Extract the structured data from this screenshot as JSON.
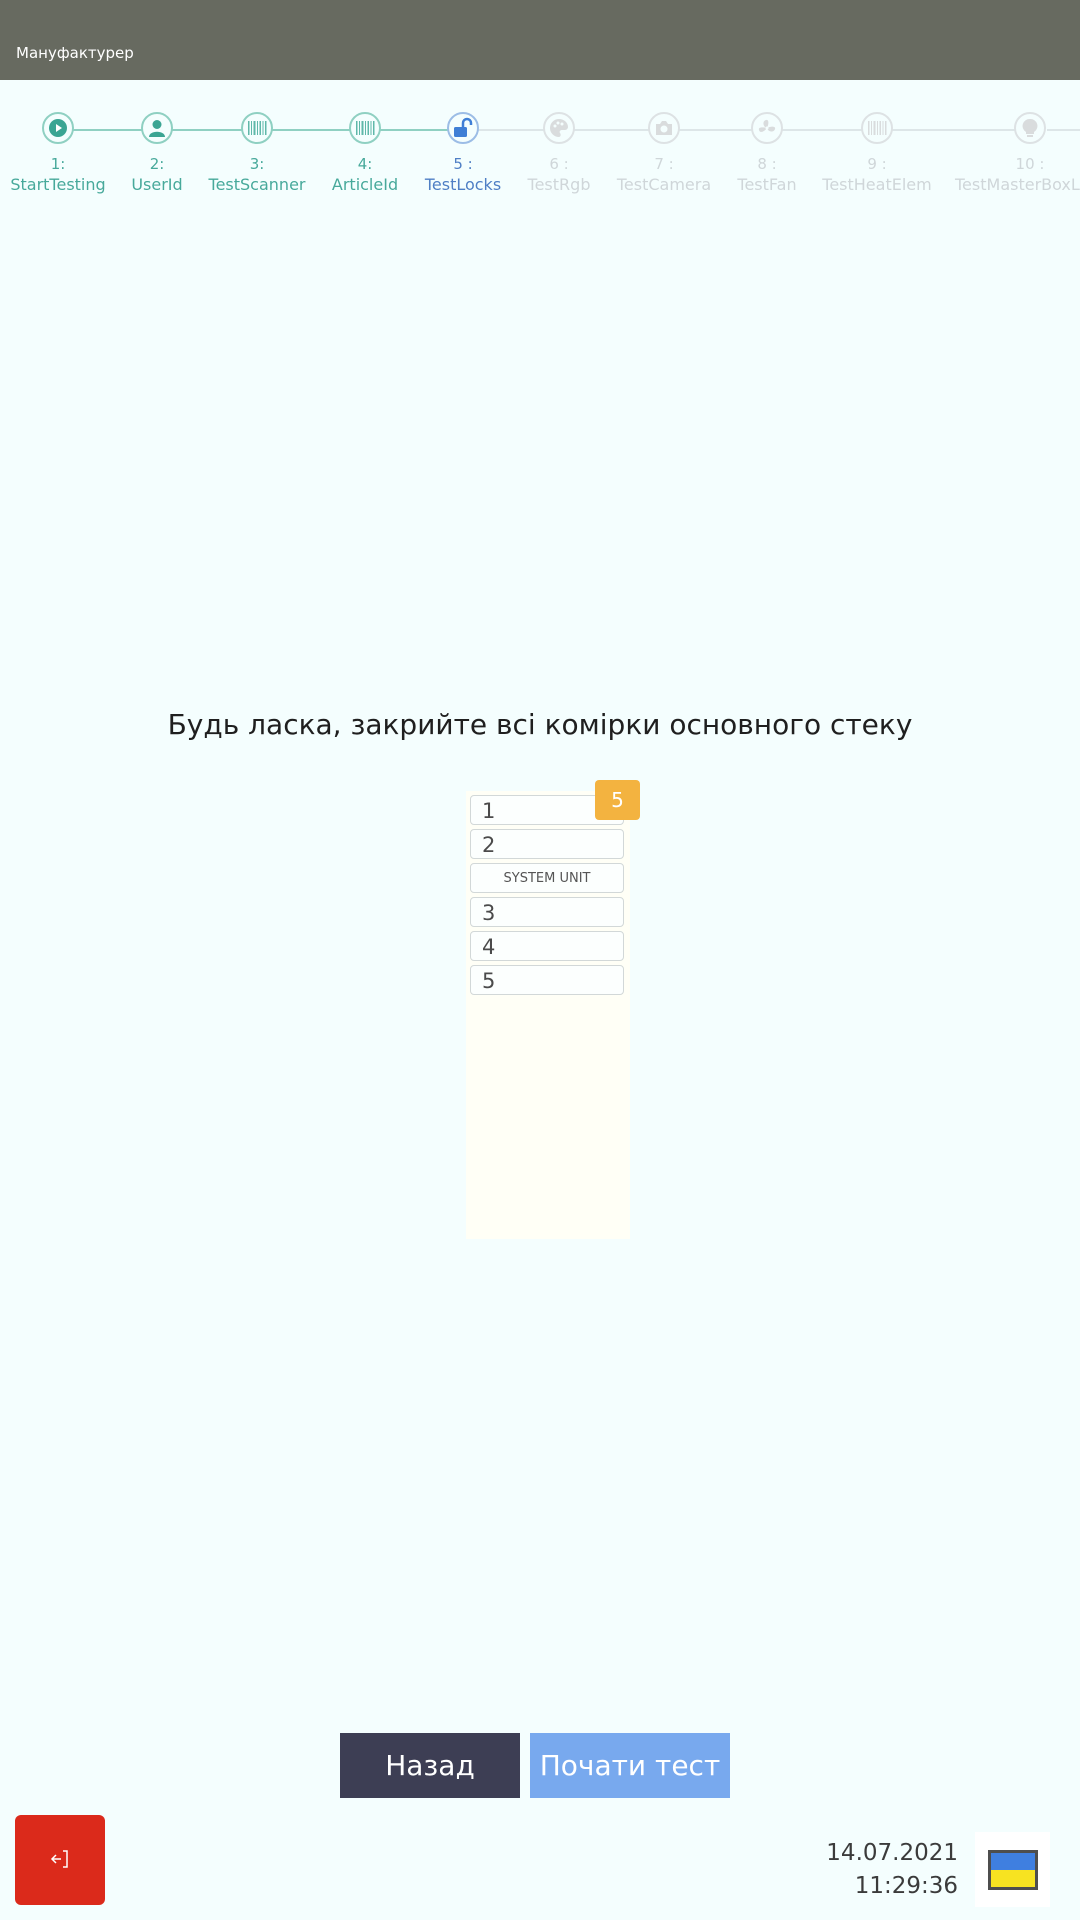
{
  "header": {
    "title": "Мануфактурер"
  },
  "steps": [
    {
      "num": "1:",
      "label": "StartTesting",
      "icon": "play-icon",
      "state": "done"
    },
    {
      "num": "2:",
      "label": "UserId",
      "icon": "user-icon",
      "state": "done"
    },
    {
      "num": "3:",
      "label": "TestScanner",
      "icon": "barcode-icon",
      "state": "done"
    },
    {
      "num": "4:",
      "label": "ArticleId",
      "icon": "barcode-icon",
      "state": "done"
    },
    {
      "num": "5 :",
      "label": "TestLocks",
      "icon": "unlock-icon",
      "state": "active"
    },
    {
      "num": "6 :",
      "label": "TestRgb",
      "icon": "palette-icon",
      "state": "pending"
    },
    {
      "num": "7 :",
      "label": "TestCamera",
      "icon": "camera-icon",
      "state": "pending"
    },
    {
      "num": "8 :",
      "label": "TestFan",
      "icon": "fan-icon",
      "state": "pending"
    },
    {
      "num": "9 :",
      "label": "TestHeatElem",
      "icon": "barcode-icon",
      "state": "pending"
    },
    {
      "num": "10 :",
      "label": "TestMasterBoxLight",
      "icon": "lightbulb-icon",
      "state": "pending"
    }
  ],
  "main": {
    "instruction": "Будь ласка, закрийте всі комірки основного стеку",
    "badge": "5",
    "cells": [
      "1",
      "2",
      "SYSTEM UNIT",
      "3",
      "4",
      "5"
    ]
  },
  "buttons": {
    "back": "Назад",
    "start": "Почати тест"
  },
  "footer": {
    "date": "14.07.2021",
    "time": "11:29:36",
    "language_flag": "ukraine-flag-icon"
  },
  "colors": {
    "header": "#676a60",
    "done": "#47a99b",
    "active": "#4f7fc5",
    "badge": "#f3b340",
    "exit": "#db2a1b"
  }
}
